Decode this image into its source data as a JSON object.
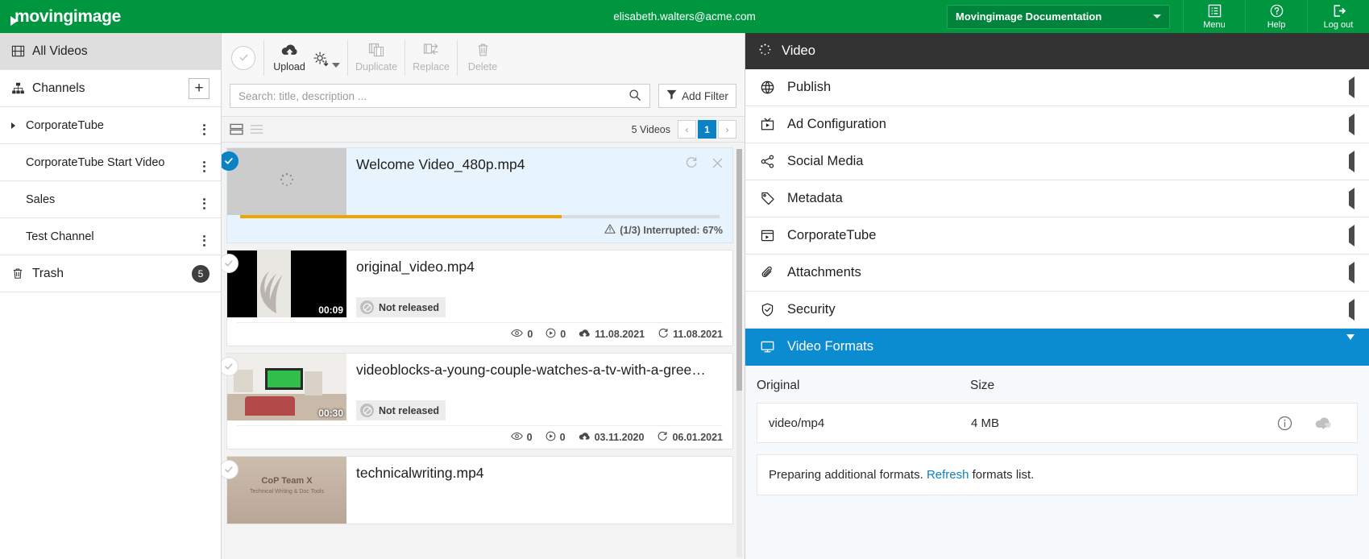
{
  "header": {
    "brand": "movingimage",
    "user_email": "elisabeth.walters@acme.com",
    "tenant": "Movingimage Documentation",
    "buttons": [
      {
        "label": "Menu",
        "icon": "menu-list-icon"
      },
      {
        "label": "Help",
        "icon": "help-circle-icon"
      },
      {
        "label": "Log out",
        "icon": "logout-icon"
      }
    ],
    "brand_color": "#009640"
  },
  "sidebar": {
    "all_videos": {
      "label": "All Videos",
      "icon": "film-icon"
    },
    "channels": {
      "label": "Channels",
      "icon": "sitemap-icon",
      "add_label": "+"
    },
    "items": [
      {
        "label": "CorporateTube",
        "expandable": true
      },
      {
        "label": "CorporateTube Start Video",
        "expandable": false
      },
      {
        "label": "Sales",
        "expandable": false
      },
      {
        "label": "Test Channel",
        "expandable": false
      }
    ],
    "trash": {
      "label": "Trash",
      "count": "5",
      "icon": "trash-icon"
    }
  },
  "toolbar": {
    "upload_label": "Upload",
    "duplicate_label": "Duplicate",
    "replace_label": "Replace",
    "delete_label": "Delete"
  },
  "search": {
    "placeholder": "Search: title, description ...",
    "add_filter_label": "Add Filter"
  },
  "list_header": {
    "count_label": "5 Videos",
    "page_prev": "‹",
    "page_current": "1",
    "page_next": "›"
  },
  "videos": [
    {
      "title": "Welcome Video_480p.mp4",
      "selected": true,
      "thumb": "placeholder",
      "duration": "",
      "status": "",
      "uploading": true,
      "progress_percent": 67,
      "upload_status": "(1/3) Interrupted: 67%",
      "views": "",
      "plays": "",
      "uploaded_date": "",
      "updated_date": ""
    },
    {
      "title": "original_video.mp4",
      "selected": false,
      "thumb": "feather",
      "duration": "00:09",
      "status": "Not released",
      "uploading": false,
      "views": "0",
      "plays": "0",
      "uploaded_date": "11.08.2021",
      "updated_date": "11.08.2021"
    },
    {
      "title": "videoblocks-a-young-couple-watches-a-tv-with-a-gree…",
      "selected": false,
      "thumb": "livingroom",
      "duration": "00:30",
      "status": "Not released",
      "uploading": false,
      "views": "0",
      "plays": "0",
      "uploaded_date": "03.11.2020",
      "updated_date": "06.01.2021"
    },
    {
      "title": "technicalwriting.mp4",
      "selected": false,
      "thumb": "copteam",
      "duration": "",
      "status": "",
      "uploading": false,
      "views": "",
      "plays": "",
      "uploaded_date": "",
      "updated_date": ""
    }
  ],
  "right_panel": {
    "title": "Video",
    "sections": [
      {
        "label": "Publish",
        "icon": "globe-icon",
        "expanded": false
      },
      {
        "label": "Ad Configuration",
        "icon": "tv-ad-icon",
        "expanded": false
      },
      {
        "label": "Social Media",
        "icon": "share-icon",
        "expanded": false
      },
      {
        "label": "Metadata",
        "icon": "tag-icon",
        "expanded": false
      },
      {
        "label": "CorporateTube",
        "icon": "window-icon",
        "expanded": false
      },
      {
        "label": "Attachments",
        "icon": "paperclip-icon",
        "expanded": false
      },
      {
        "label": "Security",
        "icon": "shield-icon",
        "expanded": false
      },
      {
        "label": "Video Formats",
        "icon": "monitor-icon",
        "expanded": true
      }
    ],
    "formats": {
      "columns": [
        "Original",
        "Size"
      ],
      "rows": [
        {
          "format": "video/mp4",
          "size": "4 MB"
        }
      ],
      "note_before": "Preparing additional formats. ",
      "note_link": "Refresh",
      "note_after": " formats list."
    },
    "accent_color": "#0b8cd0"
  }
}
